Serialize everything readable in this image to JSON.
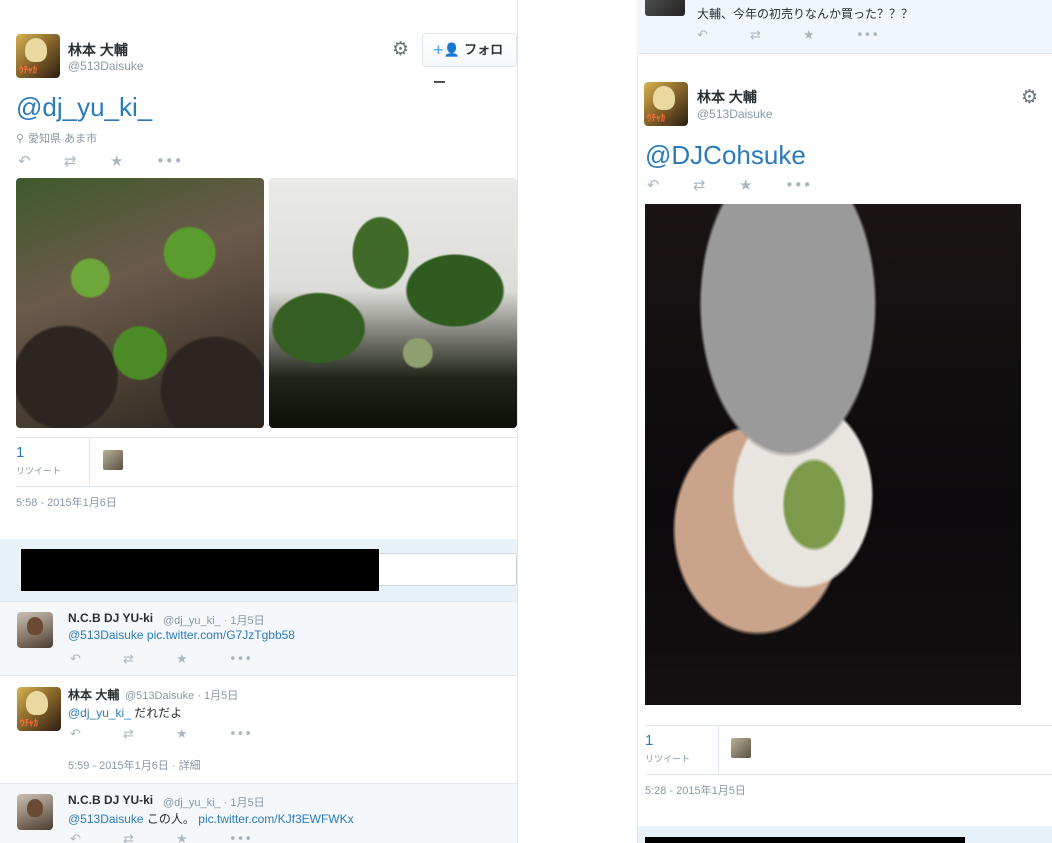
{
  "left_tweet": {
    "author_name": "林本 大輔",
    "author_handle": "@513Daisuke",
    "follow_label": "フォロー",
    "mention": "@dj_yu_ki_",
    "location": "愛知県 あま市",
    "retweet_count": "1",
    "retweet_label": "リツイート",
    "timestamp": "5:58 - 2015年1月6日"
  },
  "replies": [
    {
      "name": "N.C.B DJ YU-ki",
      "meta": "@dj_yu_ki_ · 1月5日",
      "mention": "@513Daisuke",
      "text": "",
      "link": "pic.twitter.com/G7JzTgbb58"
    },
    {
      "name": "林本 大輔",
      "meta": "@513Daisuke · 1月5日",
      "mention": "@dj_yu_ki_",
      "text": "だれだよ",
      "link": "",
      "footer": "5:59 - 2015年1月6日 · 詳細"
    },
    {
      "name": "N.C.B DJ YU-ki",
      "meta": "@dj_yu_ki_ · 1月5日",
      "mention": "@513Daisuke",
      "text": "この人。",
      "link": "pic.twitter.com/KJf3EWFWKx"
    }
  ],
  "right_top": {
    "text": "大輔、今年の初売りなんか買った？？？"
  },
  "right_tweet": {
    "author_name": "林本 大輔",
    "author_handle": "@513Daisuke",
    "mention": "@DJCohsuke",
    "retweet_count": "1",
    "retweet_label": "リツイート",
    "timestamp": "5:28 - 2015年1月5日"
  },
  "icons": {
    "reply": "reply-icon",
    "retweet": "retweet-icon",
    "favorite": "star-icon",
    "more": "more-icon",
    "settings": "gear-icon",
    "location": "pin-icon"
  }
}
